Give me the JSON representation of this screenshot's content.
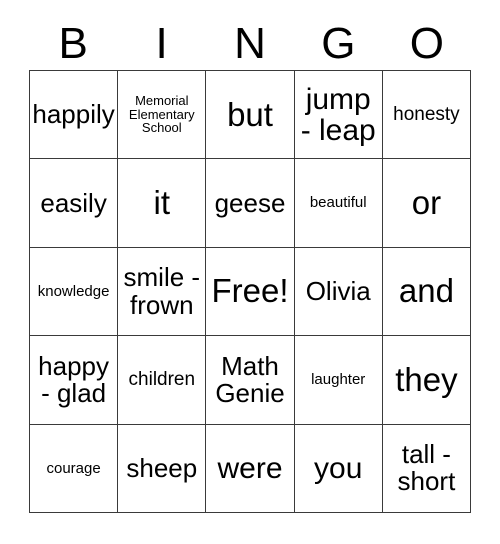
{
  "card": {
    "header_letters": [
      "B",
      "I",
      "N",
      "G",
      "O"
    ],
    "rows": [
      [
        {
          "text": "happily",
          "size": "t-md"
        },
        {
          "text": "Memorial\nElementary\nSchool",
          "size": "t-xxs"
        },
        {
          "text": "but",
          "size": "t-xl"
        },
        {
          "text": "jump\n- leap",
          "size": "t-lg"
        },
        {
          "text": "honesty",
          "size": "t-sm"
        }
      ],
      [
        {
          "text": "easily",
          "size": "t-md"
        },
        {
          "text": "it",
          "size": "t-xl"
        },
        {
          "text": "geese",
          "size": "t-md"
        },
        {
          "text": "beautiful",
          "size": "t-xs"
        },
        {
          "text": "or",
          "size": "t-xl"
        }
      ],
      [
        {
          "text": "knowledge",
          "size": "t-xs"
        },
        {
          "text": "smile -\nfrown",
          "size": "t-md"
        },
        {
          "text": "Free!",
          "size": "t-xl"
        },
        {
          "text": "Olivia",
          "size": "t-md"
        },
        {
          "text": "and",
          "size": "t-xl"
        }
      ],
      [
        {
          "text": "happy\n- glad",
          "size": "t-md"
        },
        {
          "text": "children",
          "size": "t-sm"
        },
        {
          "text": "Math\nGenie",
          "size": "t-md"
        },
        {
          "text": "laughter",
          "size": "t-xs"
        },
        {
          "text": "they",
          "size": "t-xl"
        }
      ],
      [
        {
          "text": "courage",
          "size": "t-xs"
        },
        {
          "text": "sheep",
          "size": "t-md"
        },
        {
          "text": "were",
          "size": "t-lg"
        },
        {
          "text": "you",
          "size": "t-lg"
        },
        {
          "text": "tall -\nshort",
          "size": "t-md"
        }
      ]
    ],
    "colors": {
      "border": "#3a3a3a",
      "background": "#ffffff",
      "text": "#000000"
    }
  }
}
